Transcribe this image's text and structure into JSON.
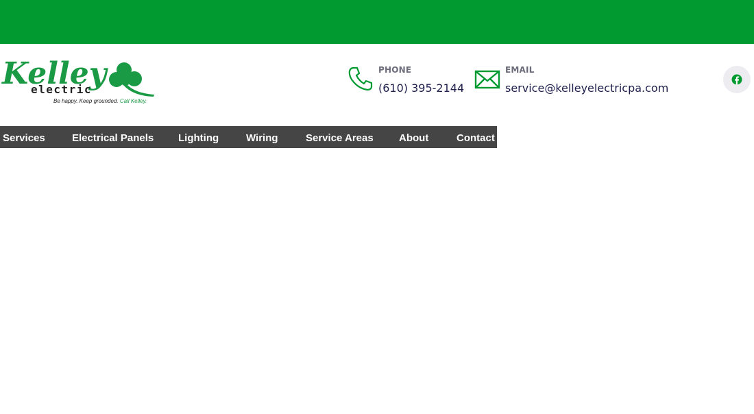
{
  "brand": {
    "name_line1": "Kelley",
    "name_line2": "electric",
    "tagline_part1": "Be happy. Keep grounded.",
    "tagline_part2": "Call Kelley.",
    "primary_color": "#009a31",
    "nav_bg_color": "#454545"
  },
  "contact": {
    "phone_label": "PHONE",
    "phone_value": "(610) 395-2144",
    "phone_icon": "phone-icon",
    "email_label": "EMAIL",
    "email_value": "service@kelleyelectricpa.com",
    "email_icon": "envelope-icon"
  },
  "social": {
    "facebook_icon": "facebook-icon"
  },
  "nav": {
    "items": [
      {
        "label": "Services"
      },
      {
        "label": "Electrical Panels"
      },
      {
        "label": "Lighting"
      },
      {
        "label": "Wiring"
      },
      {
        "label": "Service Areas"
      },
      {
        "label": "About"
      },
      {
        "label": "Contact"
      }
    ]
  }
}
